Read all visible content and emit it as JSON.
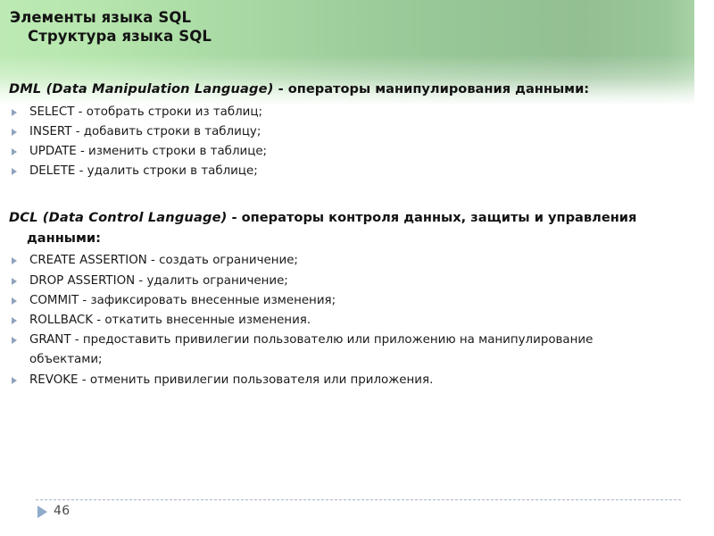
{
  "slide": {
    "title_line1": "Элементы языка SQL",
    "title_line2": "Структура языка SQL",
    "page_number": "46",
    "colors": {
      "band_left": "#bdeab4",
      "band_right": "#93bf93",
      "bullet_marker": "#8fa3bd",
      "footer_marker": "#8faacb",
      "footer_rule": "#a9b6c6",
      "text": "#111111"
    }
  },
  "sections": [
    {
      "acronym": "DML (Data Manipulation Language)",
      "description": " - операторы манипулирования данными:",
      "items": [
        "SELECT - отобрать строки из таблиц;",
        "INSERT - добавить строки в таблицу;",
        "UPDATE - изменить строки в таблице;",
        "DELETE - удалить строки в таблице;"
      ]
    },
    {
      "acronym": "DCL (Data Control Language)",
      "description": " - операторы контроля данных, защиты и управления данными:",
      "items": [
        "CREATE ASSERTION - создать ограничение;",
        "DROP ASSERTION - удалить ограничение;",
        "COMMIT - зафиксировать внесенные изменения;",
        "ROLLBACK - откатить внесенные изменения.",
        "GRANT - предоставить привилегии пользователю или приложению на манипулирование объектами;",
        "REVOKE - отменить привилегии пользователя или приложения."
      ]
    }
  ]
}
